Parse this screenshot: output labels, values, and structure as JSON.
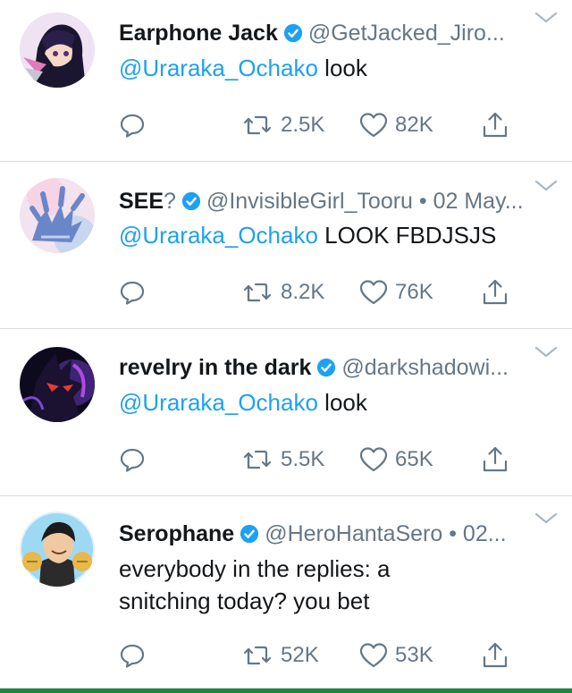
{
  "tweets": [
    {
      "name": "Earphone Jack",
      "handle": "@GetJacked_Jiro...",
      "mention": "@Uraraka_Ochako",
      "text": " look",
      "retweets": "2.5K",
      "likes": "82K",
      "avatar_colors": [
        "#1b1630",
        "#5c2a7a",
        "#e07ab8"
      ]
    },
    {
      "name": "SEE",
      "name_suffix": "?",
      "handle": "@InvisibleGirl_Tooru • 02 May...",
      "mention": "@Uraraka_Ochako",
      "text": " LOOK FBDJSJS",
      "retweets": "8.2K",
      "likes": "76K",
      "avatar_colors": [
        "#f3e3ee",
        "#c9d6f0",
        "#6a86c9"
      ]
    },
    {
      "name": "revelry in the dark",
      "handle": "@darkshadowi...",
      "mention": "@Uraraka_Ochako",
      "text": " look",
      "retweets": "5.5K",
      "likes": "65K",
      "avatar_colors": [
        "#0e0a1e",
        "#4a2a8a",
        "#b04adf"
      ]
    },
    {
      "name": "Serophane",
      "handle": "@HeroHantaSero • 02...",
      "text_line1": "everybody in the replies: a",
      "text_line2": "snitching today? you bet",
      "retweets": "52K",
      "likes": "53K",
      "avatar_colors": [
        "#dff0fa",
        "#6fc7ee",
        "#e8b84a"
      ]
    }
  ],
  "icons": {
    "reply": "reply-icon",
    "retweet": "retweet-icon",
    "like": "heart-icon",
    "share": "share-icon",
    "verified": "verified-badge-icon",
    "menu": "chevron-down-icon"
  },
  "colors": {
    "link": "#1da1f2",
    "verified": "#1da1f2",
    "secondary": "#657786",
    "divider": "#d7dbde",
    "bottom_bar": "#1a8a3a"
  }
}
